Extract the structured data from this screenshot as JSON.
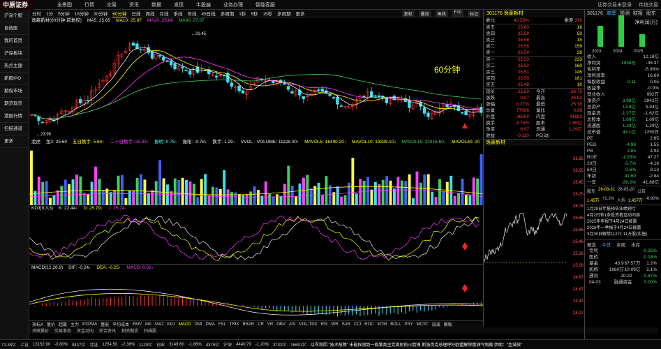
{
  "topbar": {
    "logo": "中原证券",
    "menu": [
      "全景图",
      "行情",
      "交易",
      "资讯",
      "数据",
      "发现",
      "牛股遍",
      "业务办理",
      "智能客服"
    ],
    "right": [
      "证券交易未登录",
      "传统交易"
    ]
  },
  "left_nav": [
    "沪深个股",
    "自选股",
    "我的首页",
    "沪深板块",
    "热点主题",
    "新股IPO",
    "期权市场",
    "期货现货",
    "港股行情",
    "扫描通道",
    "更多"
  ],
  "chart_tools": {
    "items": [
      "分时",
      "1分",
      "5分钟",
      "15分钟",
      "30分钟",
      "60分钟",
      "日线",
      "周线",
      "月线",
      "季线",
      "年线",
      "45日线",
      "多周期",
      "1秒",
      "5秒",
      "15秒",
      "多周期",
      "更多"
    ],
    "selected": "60分钟",
    "right": [
      "复权",
      "叠加",
      "画线",
      "F10",
      "标记"
    ]
  },
  "kline": {
    "title": "逸豪新材(60分钟,前复权)",
    "legend": [
      {
        "t": "MA5: 25.65",
        "c": "#eee"
      },
      {
        "t": "MA10: 25.87",
        "c": "#ff0"
      },
      {
        "t": "MA20: 25.88",
        "c": "#ff40ff"
      },
      {
        "t": "MA60: 27.07",
        "c": "#3cd060"
      }
    ],
    "high_label": "31.45",
    "low_label": "23.95",
    "period_label": "60分钟"
  },
  "vol": {
    "legend": [
      {
        "t": "龙虎",
        "c": "#eee"
      },
      {
        "t": "龙2: 25.60",
        "c": "#eee"
      },
      {
        "t": "五日换手: 5.64↑",
        "c": "#ff0"
      },
      {
        "t": "二十日换手: 25.33↑",
        "c": "#ff40ff"
      },
      {
        "t": "振明: 0.78↑",
        "c": "#4ff"
      },
      {
        "t": "振阳: -0.78↓",
        "c": "#eee"
      },
      {
        "t": "换手: 1.29↓",
        "c": "#eee"
      },
      {
        "t": "VVOL - VOLUME: 11128.00↑",
        "c": "#eee"
      },
      {
        "t": "MAVOL5: 18490.20↑",
        "c": "#ff0"
      },
      {
        "t": "MAVOL10: 19339.10↓",
        "c": "#ff0"
      },
      {
        "t": "MAVOL15: 22916.60↓",
        "c": "#3cd060"
      },
      {
        "t": "MAVOL60: 20",
        "c": "#ff0"
      }
    ]
  },
  "kdj": {
    "legend": [
      {
        "t": "KDJ(9,3,3)",
        "c": "#eee"
      },
      {
        "t": "K: 22.44↓",
        "c": "#eee"
      },
      {
        "t": "D: 25.79↓",
        "c": "#ff0"
      },
      {
        "t": "J: 15.74↓",
        "c": "#ff40ff"
      }
    ]
  },
  "macd": {
    "legend": [
      {
        "t": "MACD(12,26,9)",
        "c": "#eee"
      },
      {
        "t": "DIF: -0.24↓",
        "c": "#eee"
      },
      {
        "t": "DEA: -0.25↑",
        "c": "#ff0"
      },
      {
        "t": "MACD: 0.02↓",
        "c": "#ff40ff"
      }
    ]
  },
  "ind_tabs": {
    "items": [
      "指标A",
      "量价",
      "超赢",
      "主力",
      "EXPMA",
      "量能",
      "平均成本",
      "EMV",
      "MA",
      "MA2",
      "KDJ",
      "MACD",
      "DMI",
      "DMA",
      "FSL",
      "TRIX",
      "BRAR",
      "CR",
      "VR",
      "OBV",
      "ASI",
      "VOL-TDX",
      "RSI",
      "WR",
      "SAR",
      "CCI",
      "ROC",
      "MTM",
      "BOLL",
      "PSY",
      "MCST",
      "加减",
      "模板"
    ],
    "selected": "MACD"
  },
  "bottom_tabs": [
    "关联报价",
    "交易事务",
    "资金动向",
    "综合资讯",
    "相关期货",
    "扫描股"
  ],
  "quote": {
    "code": "301176",
    "name": "逸豪新材",
    "wb": {
      "label": "委比",
      "pct": "43.55%",
      "lbl2": "委差",
      "val": "378"
    },
    "asks": [
      {
        "n": "卖五",
        "p": "25.60",
        "v": "16"
      },
      {
        "n": "卖四",
        "p": "25.59",
        "v": "50"
      },
      {
        "n": "卖三",
        "p": "25.58",
        "v": "15"
      },
      {
        "n": "卖二",
        "p": "25.56",
        "v": "159"
      },
      {
        "n": "卖一",
        "p": "25.54",
        "v": "28"
      }
    ],
    "bids": [
      {
        "n": "买一",
        "p": "25.53",
        "v": "233"
      },
      {
        "n": "买二",
        "p": "25.52",
        "v": "160"
      },
      {
        "n": "买三",
        "p": "25.51",
        "v": "145"
      },
      {
        "n": "买四",
        "p": "25.50",
        "v": "181"
      },
      {
        "n": "买五",
        "p": "25.48",
        "v": "10"
      }
    ],
    "stats": [
      [
        "现价",
        "25.53",
        "今开",
        "26.75"
      ],
      [
        "涨跌",
        "0.07",
        "最高",
        "26.82"
      ],
      [
        "涨幅",
        "0.27%",
        "最低",
        "25.18"
      ],
      [
        "总量",
        "77696",
        "量比",
        "0.98"
      ],
      [
        "外盘",
        "36004",
        "内盘",
        "41692"
      ],
      [
        "换手",
        "4.74%",
        "股本",
        "1.69亿"
      ],
      [
        "净资",
        "8.97",
        "流通",
        "1.29亿"
      ],
      [
        "收益",
        "-0.110",
        "PE(动)",
        ""
      ]
    ],
    "intraday_title": "逸豪新材",
    "side_ticks": [
      "26.85",
      "26.65",
      "26.45",
      "26.25",
      "26.05",
      "25.86",
      "25.66",
      "25.46",
      "25.26",
      "25.06",
      "24.87",
      "24.67",
      "24.47",
      "24.27"
    ],
    "timebar_label": "60分钟"
  },
  "right_panel": {
    "code": "301176",
    "tabs": [
      "单季",
      "预测",
      "财报",
      "股东"
    ],
    "metric": "净利润(万)",
    "years": [
      "2023",
      "2024",
      "2025"
    ],
    "bars": [
      30,
      45,
      18
    ],
    "fin": [
      [
        "收入",
        "",
        "12.18亿"
      ],
      [
        "净利润",
        "-1936万",
        "-36.37"
      ],
      [
        "毛利率",
        "",
        "-5.96%"
      ],
      [
        "净利润率",
        "",
        "16.69"
      ],
      [
        "每股收益",
        "-0.11",
        "0.05"
      ],
      [
        "收益率",
        "",
        "-0.9%"
      ],
      [
        "营业收入",
        "",
        "992万"
      ],
      [
        "净资产",
        "3.98亿",
        "3942万"
      ],
      [
        "总资产",
        "13.9亿",
        "5.94亿"
      ],
      [
        "现金流",
        "-1.27亿",
        "-1.62亿"
      ],
      [
        "总股本",
        "1.69亿",
        "1.69亿"
      ],
      [
        "流通股",
        "1.29亿",
        "1.29亿"
      ],
      [
        "总市值",
        "43.1亿",
        "1250万"
      ]
    ],
    "valuation": [
      [
        "PE",
        "",
        "2.85"
      ],
      [
        "PEG",
        "-4.98",
        "1.55"
      ],
      [
        "PB",
        "2.85",
        "4.94"
      ],
      [
        "ROE",
        "-1.28%",
        "47.27"
      ]
    ],
    "perf": [
      [
        "20日",
        "-3.7%",
        "-4.16"
      ],
      [
        "60日",
        "-0.6%",
        "8.13"
      ],
      [
        "年初",
        "41.60",
        "-2.84"
      ],
      [
        "一年",
        "-39.2%",
        "41.88亿"
      ]
    ],
    "events": [
      "股东",
      "26-03-31",
      "26-03-20",
      "公告",
      "1.45万",
      "+1.1%",
      "人均",
      "1.457万",
      "-6.90%"
    ],
    "news": [
      "1月29日年报预告业绩预亏",
      "4月2日有1条投资者互动内容",
      "2025年年报于4月24日披露",
      "2026年一季报于4月24日披露",
      "3月30日解禁11271.11万股(实施)"
    ],
    "peers": {
      "title": "概念",
      "tabs": [
        "今日",
        "本周",
        "本月"
      ],
      "items": [
        {
          "n": "专利",
          "p": "-0.25%"
        },
        {
          "n": "医药",
          "p": "-0.18%"
        }
      ],
      "extra": [
        [
          "基金",
          "43.9",
          "67.57万",
          "1.2%"
        ],
        [
          "机构",
          "1860万",
          "10.09亿",
          "2.1%"
        ]
      ],
      "rank": [
        [
          "通讯",
          "10.22",
          "-0.87%"
        ],
        [
          "04-03",
          "融通资金",
          "0.00%"
        ]
      ]
    }
  },
  "status_bar": [
    "71.38亿",
    "上证",
    "13152.90",
    "-0.80%",
    "9427亿",
    "北证",
    "1254.50",
    "-2.36%",
    "1129亿",
    "创业",
    "3149.60",
    "-1.86%",
    "4375亿",
    "沪深",
    "4440.79",
    "-1.20%",
    "3732亿",
    "16691亿"
  ],
  "news_ticker": "以军称因 \"技术故障\" 未能探测到一枚黎真主党发射的火箭弹 斯洛伐克总理呼吁欧盟解除俄油气制裁 伊朗：\"圣城旅\""
}
